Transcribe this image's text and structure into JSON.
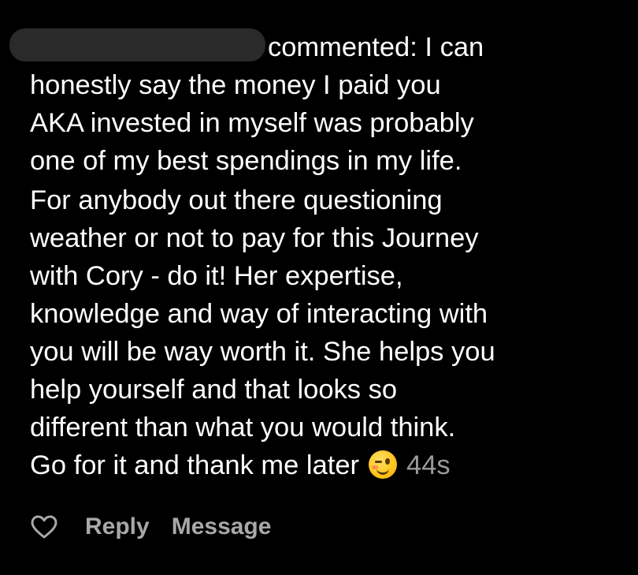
{
  "comment": {
    "lines": [
      "commented: I can",
      "honestly say the money I paid you",
      "AKA invested in myself was probably",
      "one of my best spendings in my life.",
      "For anybody out there questioning",
      "weather or not to pay for this Journey",
      "with Cory - do it! Her expertise,",
      "knowledge and way of interacting with",
      "you will be way worth it. She helps you",
      "help yourself and that looks so",
      "different than what you would think.",
      "Go for it and thank me later"
    ],
    "emoji": "winking-face",
    "timestamp": "44s"
  },
  "actions": {
    "like_icon": "heart-outline-icon",
    "reply_label": "Reply",
    "message_label": "Message"
  },
  "colors": {
    "background": "#000000",
    "text": "#ffffff",
    "secondary": "#a8a8a8"
  }
}
